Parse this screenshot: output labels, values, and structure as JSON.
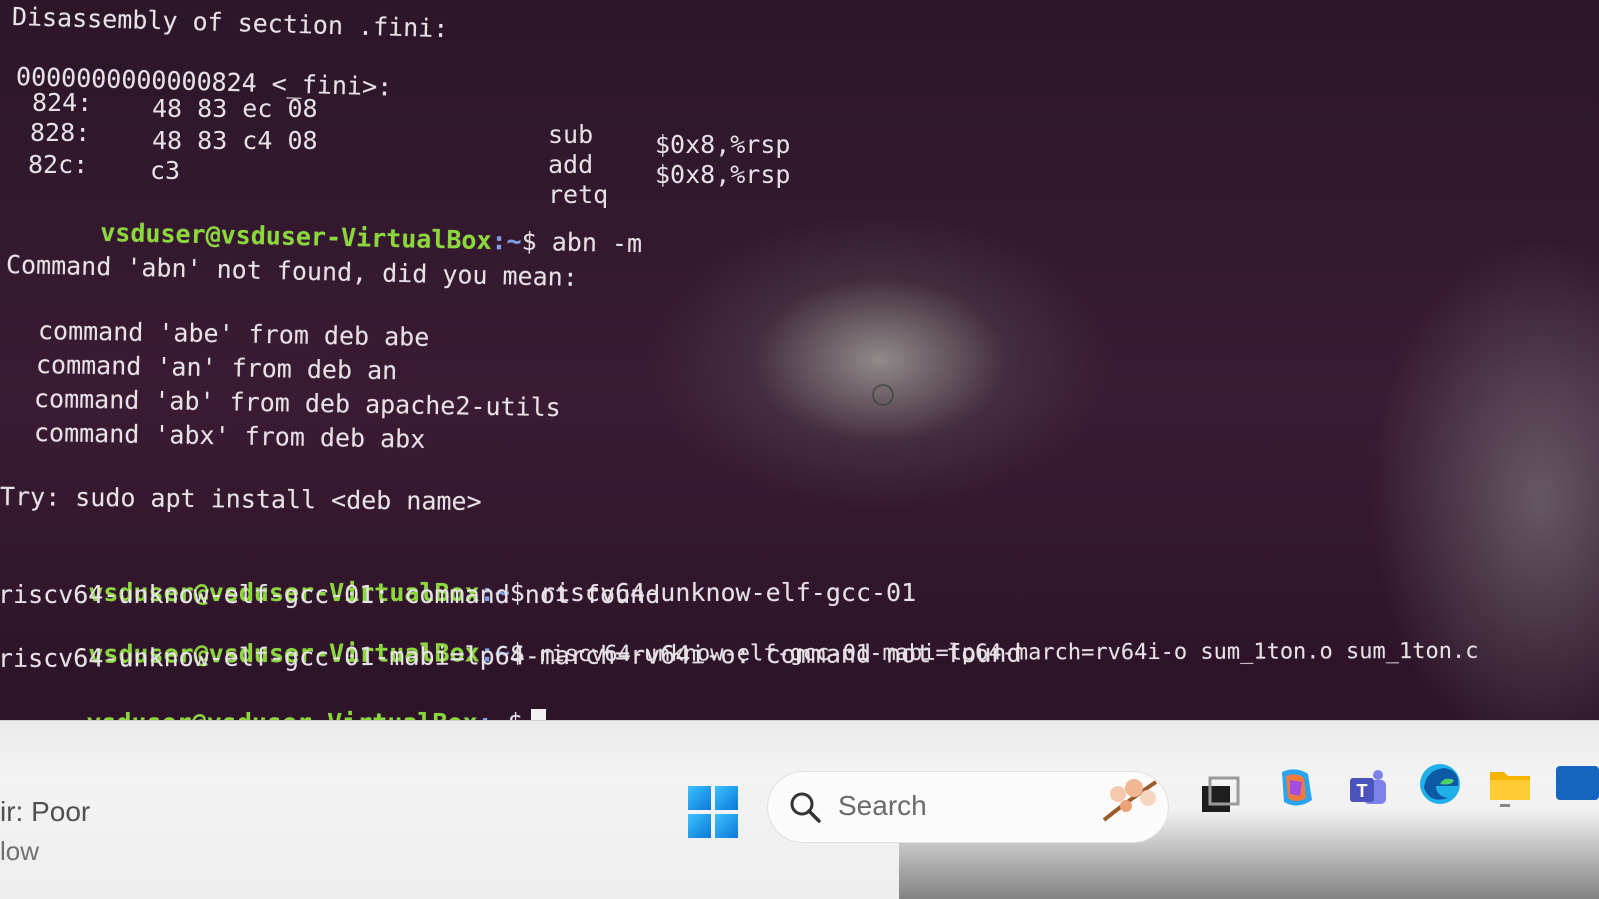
{
  "terminal": {
    "section_header": "Disassembly of section .fini:",
    "fini_label": "0000000000000824 <_fini>:",
    "disasm": [
      {
        "addr": "824:",
        "bytes": "48 83 ec 08",
        "op": "sub",
        "args": "$0x8,%rsp"
      },
      {
        "addr": "828:",
        "bytes": "48 83 c4 08",
        "op": "add",
        "args": "$0x8,%rsp"
      },
      {
        "addr": "82c:",
        "bytes": "c3",
        "op": "retq",
        "args": ""
      }
    ],
    "prompt_user": "vsduser@vsduser-VirtualBox",
    "prompt_path": ":~",
    "prompt_sign": "$",
    "cmd1": " abn -m",
    "not_found_msg": "Command 'abn' not found, did you mean:",
    "suggestions": [
      "command 'abe' from deb abe",
      "command 'an' from deb an",
      "command 'ab' from deb apache2-utils",
      "command 'abx' from deb abx"
    ],
    "try_msg": "Try: sudo apt install <deb name>",
    "cmd2": " riscv64-unknow-elf-gcc-01",
    "err2": "riscv64-unknow-elf-gcc-01: command not found",
    "cmd3": " riscv64-unknow-elf-gcc-01-mabi=lp64-march=rv64i-o sum_1ton.o sum_1ton.c",
    "err3": "riscv64-unknow-elf-gcc-01-mabi=lp64-march=rv64i-o: command not found"
  },
  "taskbar": {
    "weather_line1": "ir: Poor",
    "weather_line2": "low",
    "search_placeholder": "Search",
    "icons": [
      "windows-start-icon",
      "search-icon",
      "task-view-icon",
      "copilot-icon",
      "teams-icon",
      "edge-icon",
      "file-explorer-icon"
    ],
    "colors": {
      "prompt_user": "#8ad83a",
      "prompt_path": "#7ea0e8",
      "terminal_bg": "#300a24"
    }
  }
}
